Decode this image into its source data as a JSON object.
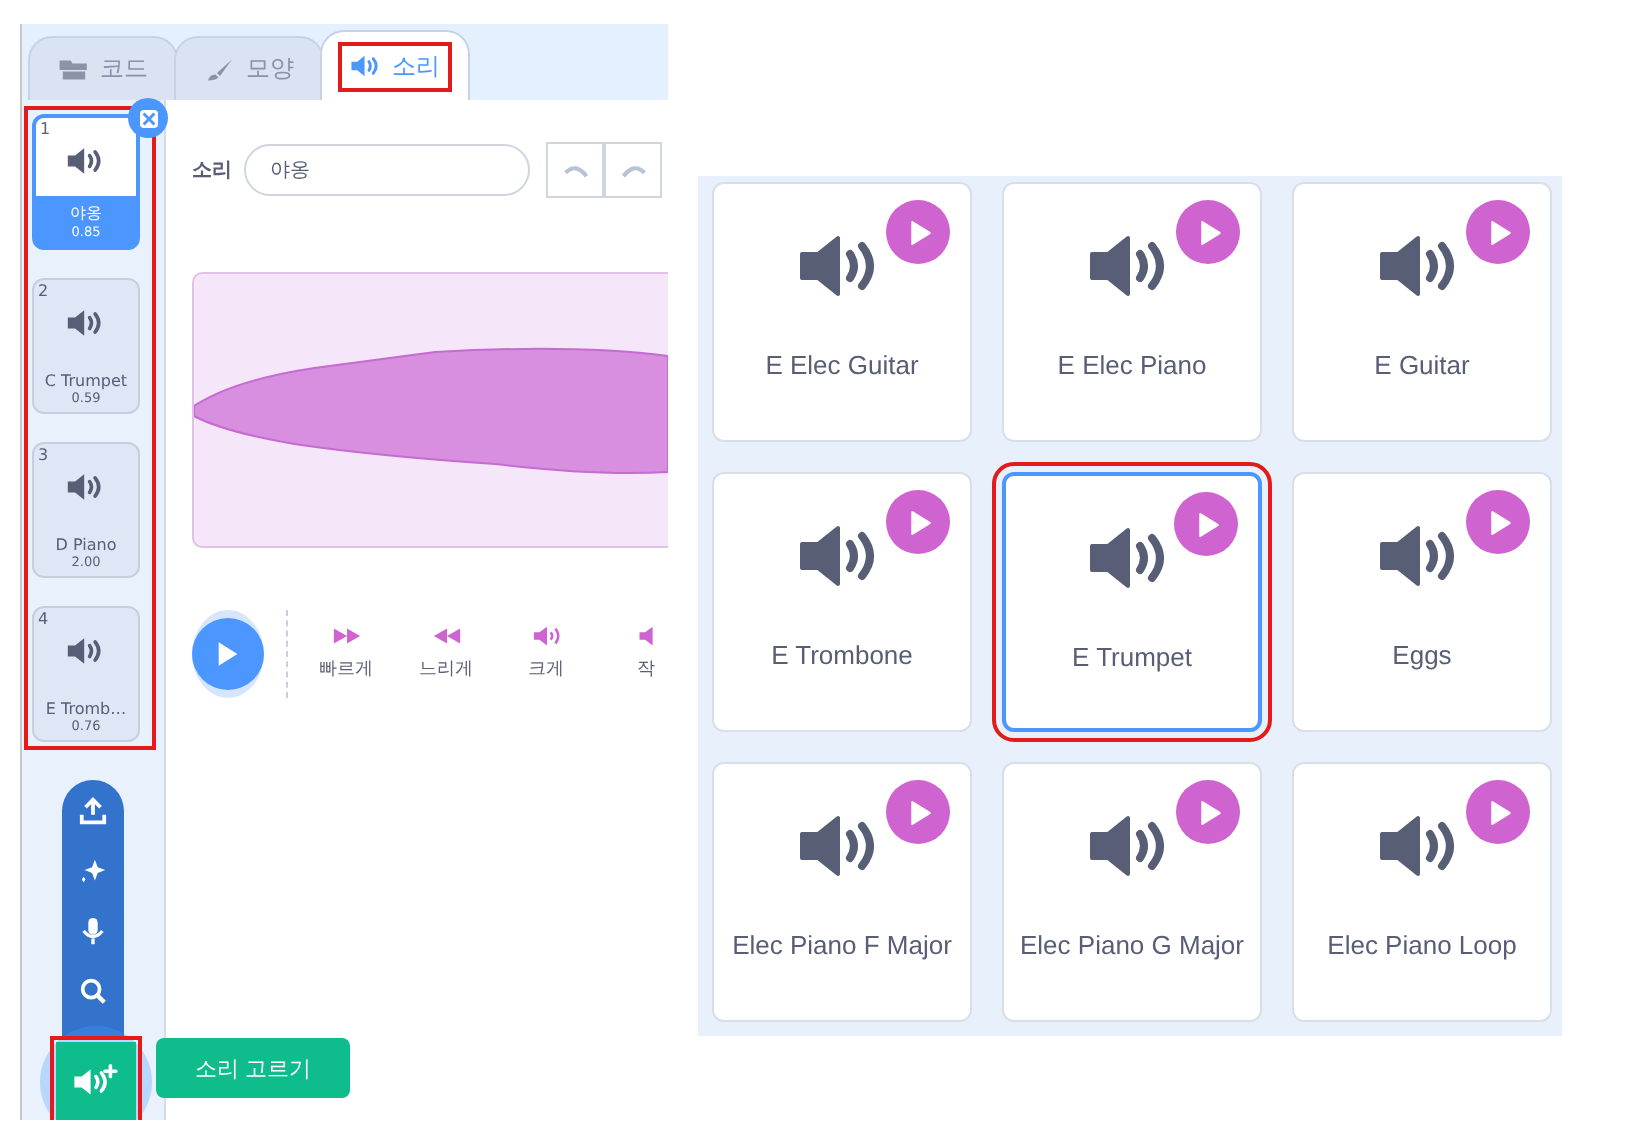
{
  "tabs": [
    {
      "label": "코드",
      "kind": "code",
      "selected": false,
      "highlighted": false
    },
    {
      "label": "모양",
      "kind": "brush",
      "selected": false,
      "highlighted": false
    },
    {
      "label": "소리",
      "kind": "sound",
      "selected": true,
      "highlighted": true
    }
  ],
  "sound_list": {
    "highlighted": true,
    "items": [
      {
        "number": "1",
        "name": "야옹",
        "duration": "0.85",
        "selected": true
      },
      {
        "number": "2",
        "name": "C Trumpet",
        "duration": "0.59",
        "selected": false
      },
      {
        "number": "3",
        "name": "D Piano",
        "duration": "2.00",
        "selected": false
      },
      {
        "number": "4",
        "name": "E Tromb…",
        "duration": "0.76",
        "selected": false
      }
    ]
  },
  "editor": {
    "label": "소리",
    "name_value": "야옹",
    "effects": [
      {
        "label": "빠르게",
        "kind": "faster"
      },
      {
        "label": "느리게",
        "kind": "slower"
      },
      {
        "label": "크게",
        "kind": "louder"
      },
      {
        "label": "작",
        "kind": "softer"
      }
    ]
  },
  "add_menu": {
    "highlighted": true,
    "tooltip": "소리 고르기"
  },
  "library": {
    "tiles": [
      {
        "name": "E Elec Guitar",
        "selected": false,
        "highlighted": false
      },
      {
        "name": "E Elec Piano",
        "selected": false,
        "highlighted": false
      },
      {
        "name": "E Guitar",
        "selected": false,
        "highlighted": false
      },
      {
        "name": "E Trombone",
        "selected": false,
        "highlighted": false
      },
      {
        "name": "E Trumpet",
        "selected": true,
        "highlighted": true
      },
      {
        "name": "Eggs",
        "selected": false,
        "highlighted": false
      },
      {
        "name": "Elec Piano F Major",
        "selected": false,
        "highlighted": false
      },
      {
        "name": "Elec Piano G Major",
        "selected": false,
        "highlighted": false
      },
      {
        "name": "Elec Piano Loop",
        "selected": false,
        "highlighted": false
      }
    ]
  }
}
